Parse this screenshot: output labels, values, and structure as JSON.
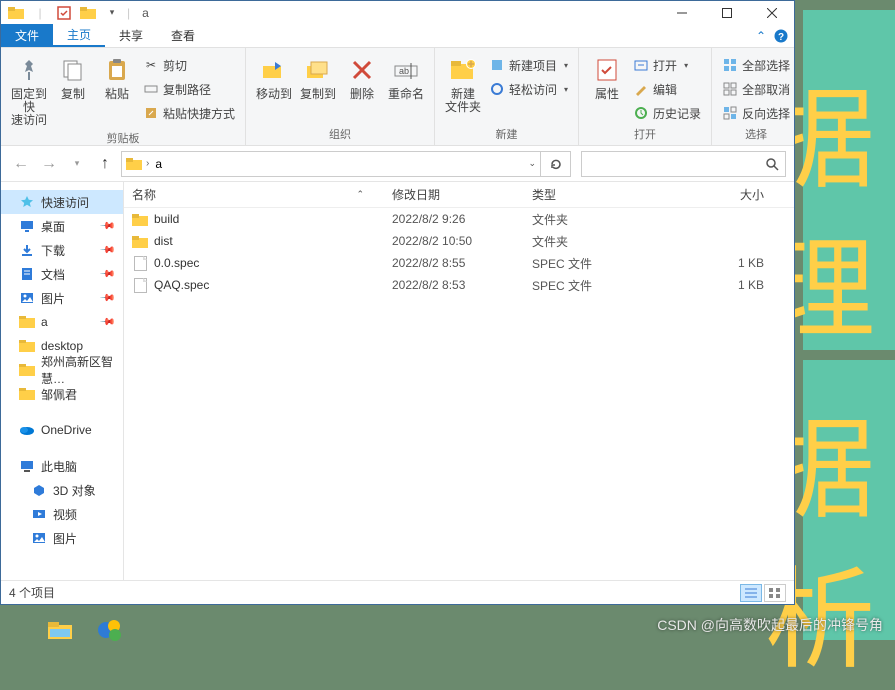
{
  "window": {
    "title": "a"
  },
  "tabs": {
    "file": "文件",
    "home": "主页",
    "share": "共享",
    "view": "查看"
  },
  "ribbon": {
    "clipboard": {
      "label": "剪贴板",
      "pin": "固定到快\n速访问",
      "copy": "复制",
      "paste": "粘贴",
      "cut": "剪切",
      "copy_path": "复制路径",
      "paste_shortcut": "粘贴快捷方式"
    },
    "organize": {
      "label": "组织",
      "move_to": "移动到",
      "copy_to": "复制到",
      "delete": "删除",
      "rename": "重命名"
    },
    "new": {
      "label": "新建",
      "new_folder": "新建\n文件夹",
      "new_item": "新建项目",
      "easy_access": "轻松访问"
    },
    "open": {
      "label": "打开",
      "properties": "属性",
      "open_btn": "打开",
      "edit": "编辑",
      "history": "历史记录"
    },
    "select": {
      "label": "选择",
      "select_all": "全部选择",
      "select_none": "全部取消",
      "invert": "反向选择"
    }
  },
  "nav": {
    "current": "a"
  },
  "search": {
    "placeholder": ""
  },
  "sidebar": {
    "items": [
      {
        "label": "快速访问",
        "icon": "star",
        "color": "#4fc0e8",
        "sel": true
      },
      {
        "label": "桌面",
        "icon": "desktop",
        "color": "#2f7bd9",
        "pin": true
      },
      {
        "label": "下载",
        "icon": "download",
        "color": "#2f7bd9",
        "pin": true
      },
      {
        "label": "文档",
        "icon": "doc",
        "color": "#2f7bd9",
        "pin": true
      },
      {
        "label": "图片",
        "icon": "pic",
        "color": "#2f7bd9",
        "pin": true
      },
      {
        "label": "a",
        "icon": "folder",
        "color": "#ffcf48",
        "pin": true
      },
      {
        "label": "desktop",
        "icon": "folder",
        "color": "#ffcf48",
        "pin": false
      },
      {
        "label": "郑州高新区智慧…",
        "icon": "folder",
        "color": "#ffcf48",
        "pin": false
      },
      {
        "label": "邹佩君",
        "icon": "folder",
        "color": "#ffcf48",
        "pin": false
      }
    ],
    "onedrive": "OneDrive",
    "thispc": "此电脑",
    "pc_items": [
      {
        "label": "3D 对象",
        "icon": "cube"
      },
      {
        "label": "视频",
        "icon": "video"
      },
      {
        "label": "图片",
        "icon": "pic"
      }
    ]
  },
  "columns": {
    "name": "名称",
    "date": "修改日期",
    "type": "类型",
    "size": "大小"
  },
  "files": [
    {
      "name": "build",
      "date": "2022/8/2 9:26",
      "type": "文件夹",
      "size": "",
      "icon": "folder"
    },
    {
      "name": "dist",
      "date": "2022/8/2 10:50",
      "type": "文件夹",
      "size": "",
      "icon": "folder"
    },
    {
      "name": "0.0.spec",
      "date": "2022/8/2 8:55",
      "type": "SPEC 文件",
      "size": "1 KB",
      "icon": "file"
    },
    {
      "name": "QAQ.spec",
      "date": "2022/8/2 8:53",
      "type": "SPEC 文件",
      "size": "1 KB",
      "icon": "file"
    }
  ],
  "status": {
    "count": "4 个项目"
  },
  "watermark": "CSDN @向高数吹起最后的冲锋号角"
}
